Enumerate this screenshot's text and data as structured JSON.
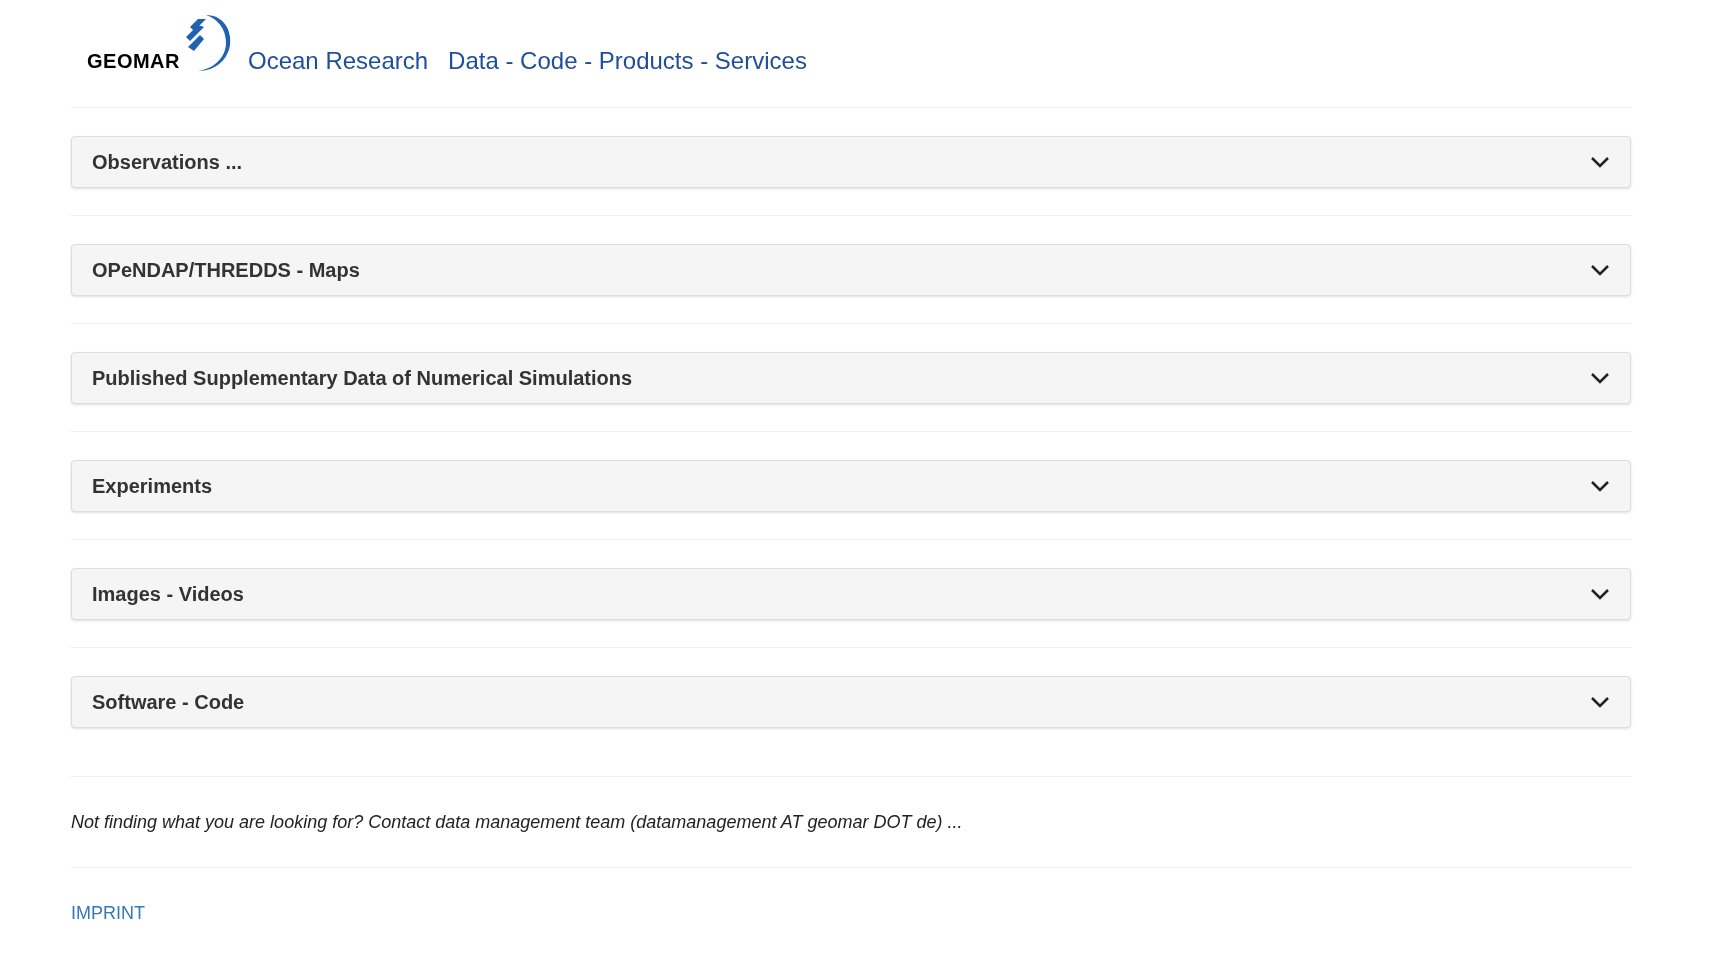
{
  "header": {
    "logo_text": "GEOMAR",
    "title": "Ocean Research",
    "subtitle": "Data - Code - Products - Services"
  },
  "sections": [
    {
      "title": "Observations ...",
      "expanded": false
    },
    {
      "title": "OPeNDAP/THREDDS - Maps",
      "expanded": false
    },
    {
      "title": "Published Supplementary Data of Numerical Simulations",
      "expanded": false
    },
    {
      "title": "Experiments",
      "expanded": false
    },
    {
      "title": "Images - Videos",
      "expanded": false
    },
    {
      "title": "Software - Code",
      "expanded": false
    }
  ],
  "footer": {
    "note": "Not finding what you are looking for? Contact data management team (datamanagement AT geomar DOT de) ...",
    "link": "IMPRINT"
  }
}
